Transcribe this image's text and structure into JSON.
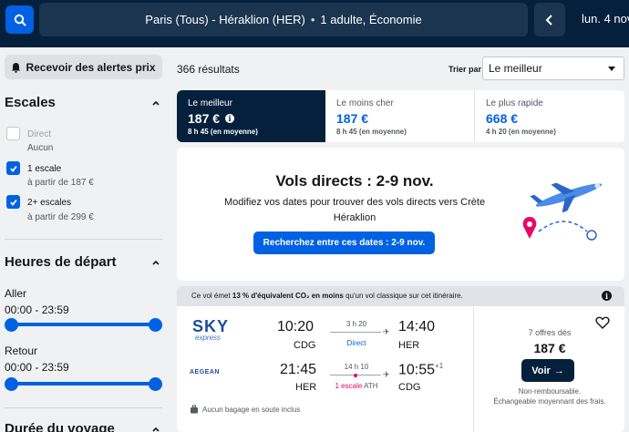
{
  "header": {
    "route": "Paris (Tous) - Héraklion (HER)",
    "separator": "•",
    "passengers": "1 adulte, Économie",
    "date": "lun. 4 nov."
  },
  "sidebar": {
    "alert_button": "Recevoir des alertes prix",
    "stops": {
      "title": "Escales",
      "options": [
        {
          "label": "Direct",
          "sub": "Aucun",
          "checked": false,
          "disabled": true
        },
        {
          "label": "1 escale",
          "sub": "à partir de 187 €",
          "checked": true,
          "disabled": false
        },
        {
          "label": "2+ escales",
          "sub": "à partir de 299 €",
          "checked": true,
          "disabled": false
        }
      ]
    },
    "departure": {
      "title": "Heures de départ",
      "outbound_label": "Aller",
      "outbound_range": "00:00 - 23:59",
      "return_label": "Retour",
      "return_range": "00:00 - 23:59"
    },
    "duration_title": "Durée du voyage"
  },
  "results": {
    "count": "366 résultats",
    "sort_label": "Trier par",
    "sort_value": "Le meilleur"
  },
  "tabs": [
    {
      "name": "Le meilleur",
      "price": "187 €",
      "duration": "8 h 45 (en moyenne)",
      "active": true
    },
    {
      "name": "Le moins cher",
      "price": "187 €",
      "duration": "8 h 45 (en moyenne)",
      "active": false
    },
    {
      "name": "Le plus rapide",
      "price": "668 €",
      "duration": "4 h 20 (en moyenne)",
      "active": false
    }
  ],
  "promo": {
    "title": "Vols directs : 2-9 nov.",
    "description": "Modifiez vos dates pour trouver des vols directs vers Crète Héraklion",
    "button": "Recherchez entre ces dates : 2-9 nov."
  },
  "flight_card": {
    "co2_prefix": "Ce vol émet",
    "co2_bold": "13 % d'équivalent CO₂ en moins",
    "co2_suffix": "qu'un vol classique sur cet itinéraire.",
    "outbound": {
      "airline_main": "SKY",
      "airline_sub": "express",
      "dep_time": "10:20",
      "dep_airport": "CDG",
      "duration": "3 h 20",
      "stops": "Direct",
      "arr_time": "14:40",
      "arr_airport": "HER"
    },
    "return": {
      "airline": "AEGEAN",
      "dep_time": "21:45",
      "dep_airport": "HER",
      "duration": "14 h 10",
      "stops_count": "1 escale",
      "stops_airport": "ATH",
      "arr_time": "10:55",
      "arr_day_offset": "+1",
      "arr_airport": "CDG"
    },
    "baggage": "Aucun bagage en soute inclus",
    "offers": "7 offres dès",
    "price": "187 €",
    "book_button": "Voir",
    "fare_note_1": "Non-remboursable.",
    "fare_note_2": "Échangeable moyennant des frais."
  },
  "colors": {
    "brand_dark": "#05203c",
    "accent_blue": "#0062e3",
    "stop_pink": "#e70866",
    "direct_blue": "#0062e3"
  }
}
